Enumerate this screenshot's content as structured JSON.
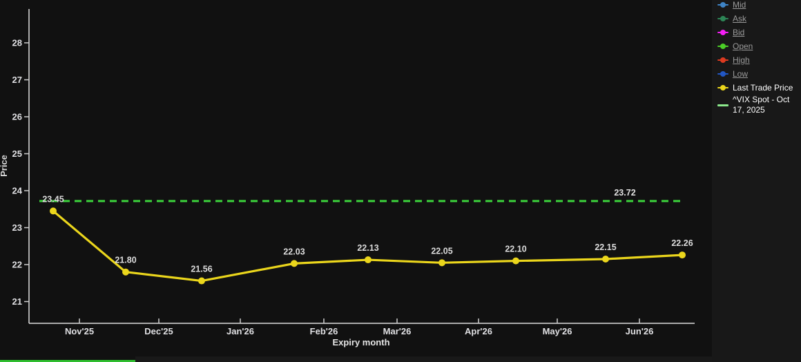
{
  "chart_data": {
    "type": "line",
    "title": "",
    "xlabel": "Expiry month",
    "ylabel": "Price",
    "x_tick_labels": [
      "Nov'25",
      "Dec'25",
      "Jan'26",
      "Feb'26",
      "Mar'26",
      "Apr'26",
      "May'26",
      "Jun'26"
    ],
    "y_ticks": [
      "21",
      "22",
      "23",
      "24",
      "25",
      "26",
      "27",
      "28"
    ],
    "ylim": [
      20.4,
      28.9
    ],
    "grid": "off",
    "legend_position": "right",
    "series": [
      {
        "name": "Last Trade Price",
        "color": "#ebd61c",
        "values": [
          23.45,
          21.8,
          21.56,
          22.03,
          22.13,
          22.05,
          22.1,
          22.15,
          22.26
        ],
        "point_labels": [
          "23.45",
          "21.80",
          "21.56",
          "22.03",
          "22.13",
          "22.05",
          "22.10",
          "22.15",
          "22.26"
        ]
      }
    ],
    "reference_line": {
      "name": "^VIX Spot - Oct 17, 2025",
      "value": 23.72,
      "label": "23.72",
      "color": "#3cd43c",
      "style": "dashed"
    }
  },
  "legend": {
    "items": [
      {
        "label": "Mid",
        "color": "#3e84c6",
        "disabled": true,
        "marker": "dot"
      },
      {
        "label": "Ask",
        "color": "#2d8556",
        "disabled": true,
        "marker": "dot"
      },
      {
        "label": "Bid",
        "color": "#f41ef4",
        "disabled": true,
        "marker": "dot"
      },
      {
        "label": "Open",
        "color": "#4cce27",
        "disabled": true,
        "marker": "dot"
      },
      {
        "label": "High",
        "color": "#dc3a20",
        "disabled": true,
        "marker": "dot"
      },
      {
        "label": "Low",
        "color": "#2257c4",
        "disabled": true,
        "marker": "dot"
      },
      {
        "label": "Last Trade Price",
        "color": "#ebd61c",
        "disabled": false,
        "marker": "dot"
      },
      {
        "label": "^VIX Spot - Oct 17, 2025",
        "color": "#8ce98c",
        "disabled": false,
        "marker": "line"
      }
    ]
  }
}
